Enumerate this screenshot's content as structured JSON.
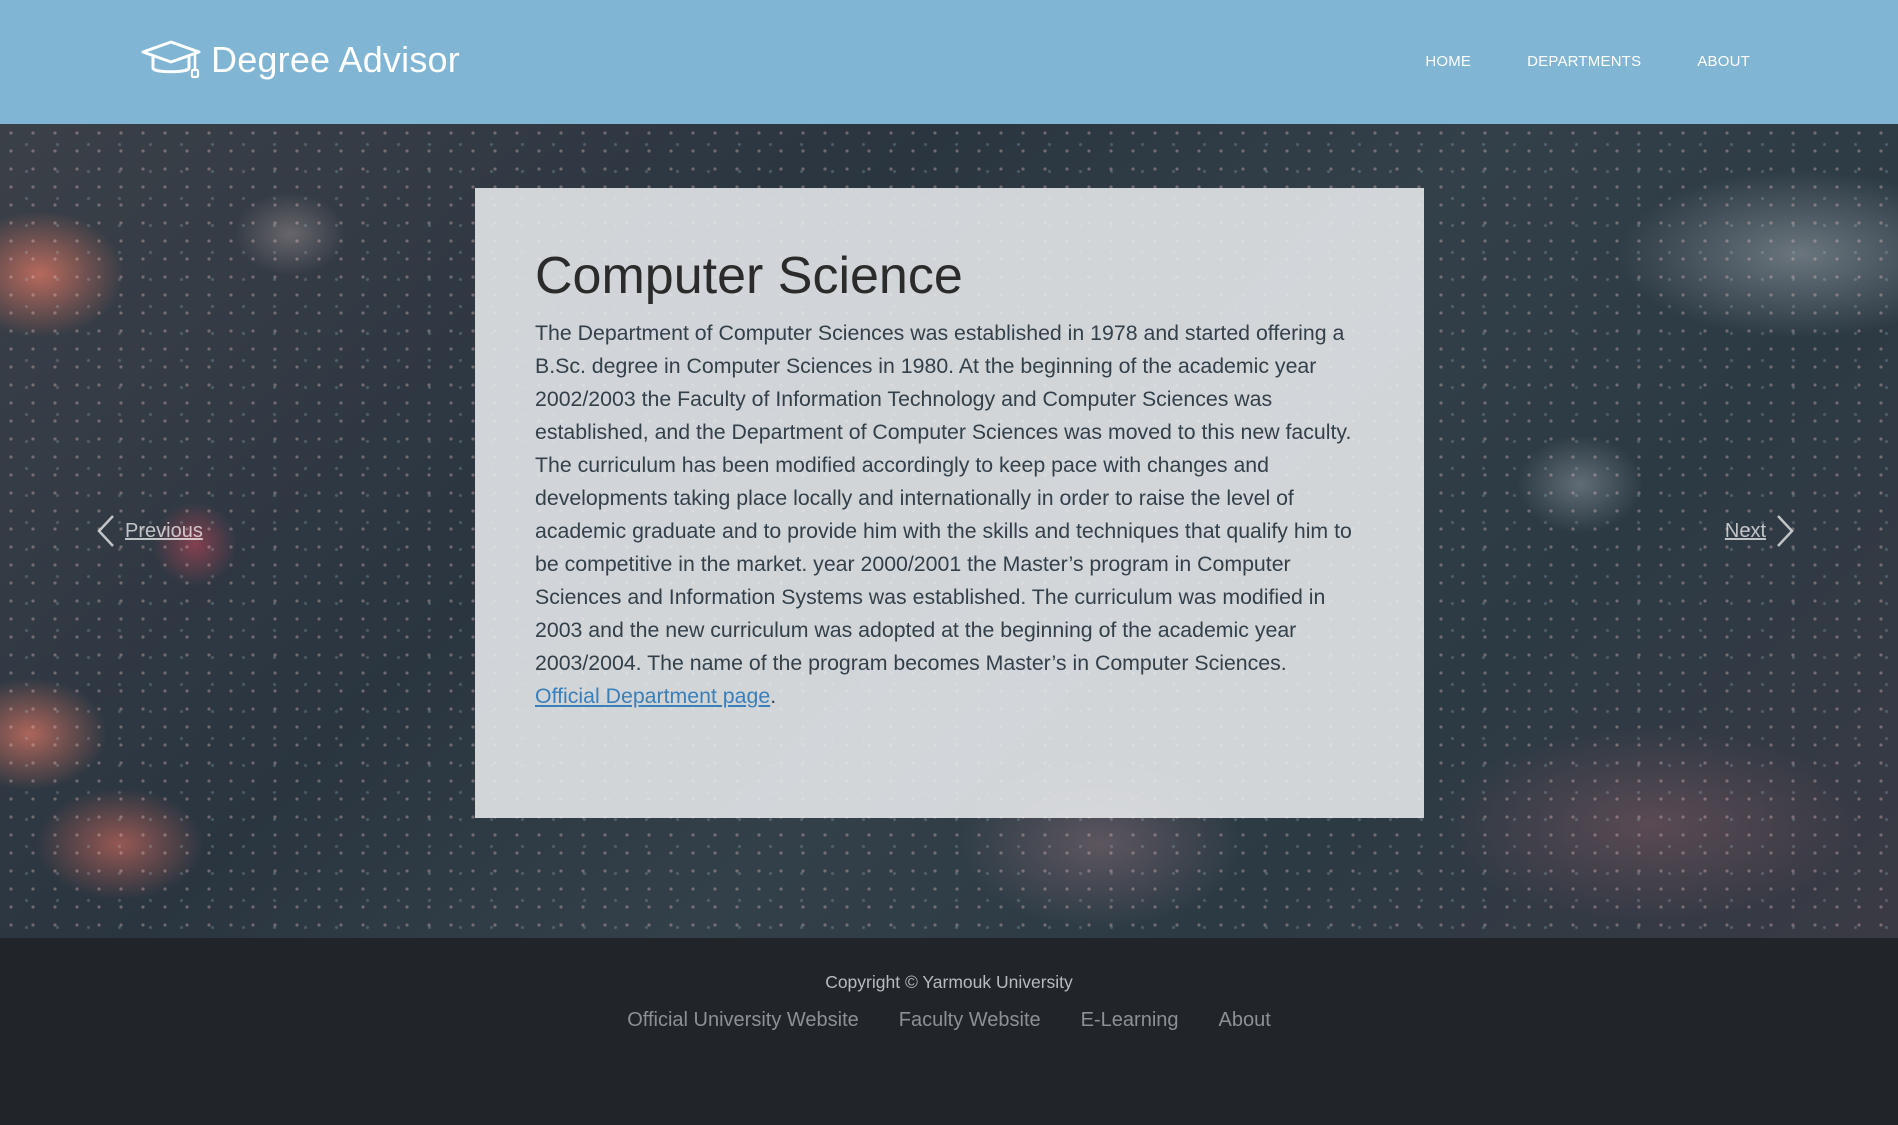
{
  "header": {
    "brand_name": "Degree Advisor",
    "brand_icon": "graduation-cap-icon",
    "nav": [
      "HOME",
      "DEPARTMENTS",
      "ABOUT"
    ],
    "background_color": "#80b5d3"
  },
  "hero": {
    "prev_label": "Previous",
    "next_label": "Next",
    "background": "circuit-board-photo"
  },
  "department": {
    "title": "Computer Science",
    "description": "The Department of Computer Sciences was established in 1978 and started offering a B.Sc. degree in Computer Sciences in 1980. At the beginning of the academic year 2002/2003 the Faculty of Information Technology and Computer Sciences was established, and the Department of Computer Sciences was moved to this new faculty. The curriculum has been modified accordingly to keep pace with changes and developments taking place locally and internationally in order to raise the level of academic graduate and to provide him with the skills and techniques that qualify him to be competitive in the market. year 2000/2001 the Master’s program in Computer Sciences and Information Systems was established. The curriculum was modified in 2003 and the new curriculum was adopted at the beginning of the academic year 2003/2004. The name of the program becomes Master’s in Computer Sciences.",
    "link_text": "Official Department page",
    "link_suffix": ".",
    "link_color": "#3a7fb8"
  },
  "footer": {
    "copyright": "Copyright © Yarmouk University",
    "links": [
      "Official University Website",
      "Faculty Website",
      "E-Learning",
      "About"
    ],
    "background_color": "#212428"
  }
}
